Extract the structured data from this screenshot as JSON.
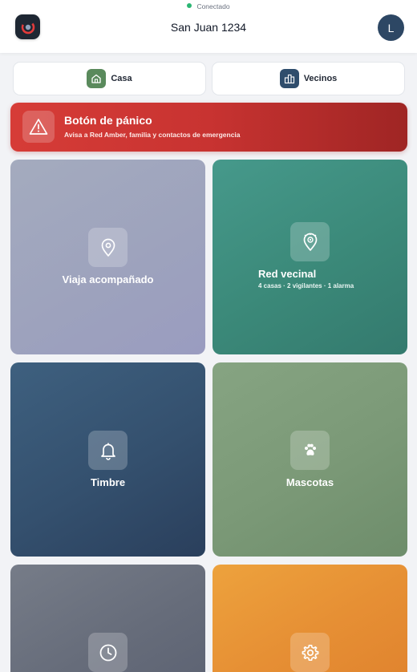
{
  "header": {
    "status": "Conectado",
    "title": "San Juan 1234",
    "avatar_initial": "L",
    "logo_icon": "app-logo-icon"
  },
  "tabs": [
    {
      "label": "Casa",
      "icon": "house-icon",
      "color": "#5a8a5c"
    },
    {
      "label": "Vecinos",
      "icon": "buildings-icon",
      "color": "#2f4d6c"
    }
  ],
  "panic": {
    "title": "Botón de pánico",
    "subtitle": "Avisa a Red Amber, familia y contactos de emergencia",
    "icon": "warning-icon",
    "color": "#cf3935"
  },
  "tiles": [
    {
      "label": "Viaja acompañado",
      "icon": "map-pin-icon",
      "color": "#a0a5bf"
    },
    {
      "label": "Red vecinal",
      "sub": "4 casas · 2 vigilantes · 1 alarma",
      "icon": "location-eye-icon",
      "color": "#3c8a7b"
    },
    {
      "label": "Timbre",
      "icon": "bell-icon",
      "color": "#34506e"
    },
    {
      "label": "Mascotas",
      "icon": "paw-icon",
      "color": "#7b9977"
    },
    {
      "label": "",
      "icon": "clock-icon",
      "color": "#666c7a"
    },
    {
      "label": "",
      "icon": "gear-icon",
      "color": "#e68f34"
    }
  ]
}
